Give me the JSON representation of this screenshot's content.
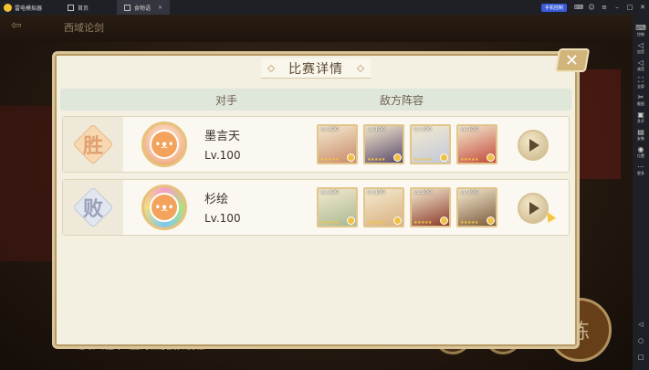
{
  "emulator": {
    "app_name": "雷电模拟器",
    "tabs": [
      {
        "label": "首页"
      },
      {
        "label": "食物语"
      }
    ],
    "sync_button": "手机控制",
    "sidebar": [
      {
        "label": "控制",
        "icon": "keyboard-icon"
      },
      {
        "label": "加音",
        "icon": "volume-up-icon"
      },
      {
        "label": "减音",
        "icon": "volume-down-icon"
      },
      {
        "label": "全屏",
        "icon": "fullscreen-icon"
      },
      {
        "label": "截图",
        "icon": "scissors-icon"
      },
      {
        "label": "多开",
        "icon": "multi-instance-icon"
      },
      {
        "label": "安装",
        "icon": "apk-install-icon"
      },
      {
        "label": "位置",
        "icon": "location-icon"
      },
      {
        "label": "更多",
        "icon": "more-icon"
      }
    ]
  },
  "background": {
    "title": "西域论剑",
    "bottom_text": "活动，欢迎每一位醉心烹饪者前来挑战。",
    "train_label": "练"
  },
  "dialog": {
    "title": "比赛详情",
    "close_label": "✕",
    "columns": {
      "opponent": "对手",
      "lineup": "敌方阵容"
    },
    "rows": [
      {
        "result": "胜",
        "result_type": "win",
        "name": "墨言天",
        "level": "Lv.100",
        "avatar_char": "",
        "heroes": [
          {
            "lv": "Lv.100",
            "color": "#c98a6a"
          },
          {
            "lv": "Lv.100",
            "color": "#5a4a6a"
          },
          {
            "lv": "Lv.100",
            "color": "#c0c8d8"
          },
          {
            "lv": "Lv.100",
            "color": "#c24a3a"
          }
        ]
      },
      {
        "result": "败",
        "result_type": "lose",
        "name": "杉绘",
        "level": "Lv.100",
        "avatar_char": "",
        "heroes": [
          {
            "lv": "Lv.100",
            "color": "#a8b890"
          },
          {
            "lv": "Lv.100",
            "color": "#d8b080"
          },
          {
            "lv": "Lv.100",
            "color": "#8a3a2a"
          },
          {
            "lv": "Lv.100",
            "color": "#7a5a3a"
          }
        ]
      }
    ],
    "star_glyphs": "★★★★★"
  }
}
